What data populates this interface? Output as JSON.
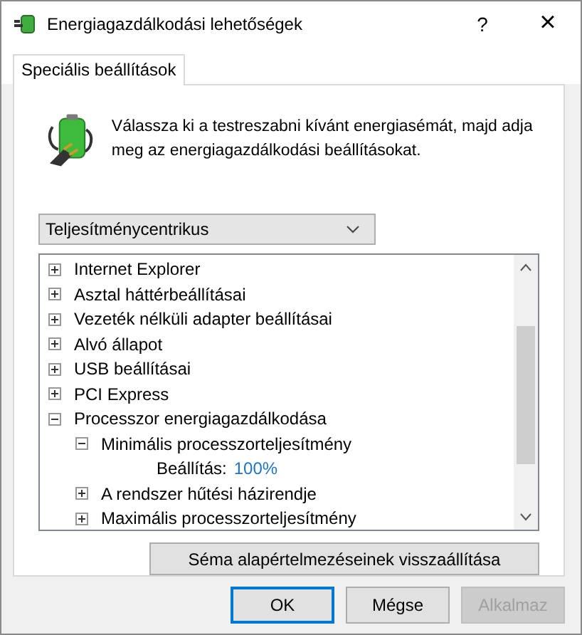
{
  "window": {
    "title": "Energiagazdálkodási lehetőségek",
    "help": "?",
    "close": "×"
  },
  "tabs": [
    {
      "label": "Speciális beállítások",
      "selected": true
    }
  ],
  "intro": "Válassza ki a testreszabni kívánt energiasémát, majd adja meg az energiagazdálkodási beállításokat.",
  "scheme_dropdown": {
    "value": "Teljesítménycentrikus"
  },
  "tree": [
    {
      "kind": "group",
      "label": "Internet Explorer",
      "expanded": false
    },
    {
      "kind": "group",
      "label": "Asztal háttérbeállításai",
      "expanded": false
    },
    {
      "kind": "group",
      "label": "Vezeték nélküli adapter beállításai",
      "expanded": false
    },
    {
      "kind": "group",
      "label": "Alvó állapot",
      "expanded": false
    },
    {
      "kind": "group",
      "label": "USB beállításai",
      "expanded": false
    },
    {
      "kind": "group",
      "label": "PCI Express",
      "expanded": false
    },
    {
      "kind": "group",
      "label": "Processzor energiagazdálkodása",
      "expanded": true,
      "children": [
        {
          "kind": "group",
          "label": "Minimális processzorteljesítmény",
          "expanded": true,
          "children": [
            {
              "kind": "setting",
              "label": "Beállítás:",
              "value": "100%"
            }
          ]
        },
        {
          "kind": "group",
          "label": "A rendszer hűtési házirendje",
          "expanded": false
        },
        {
          "kind": "group",
          "label": "Maximális processzorteljesítmény",
          "expanded": false
        }
      ]
    }
  ],
  "reset_button": "Séma alapértelmezéseinek visszaállítása",
  "buttons": [
    {
      "label": "OK",
      "default": true,
      "disabled": false
    },
    {
      "label": "Mégse",
      "default": false,
      "disabled": false
    },
    {
      "label": "Alkalmaz",
      "default": false,
      "disabled": true
    }
  ]
}
